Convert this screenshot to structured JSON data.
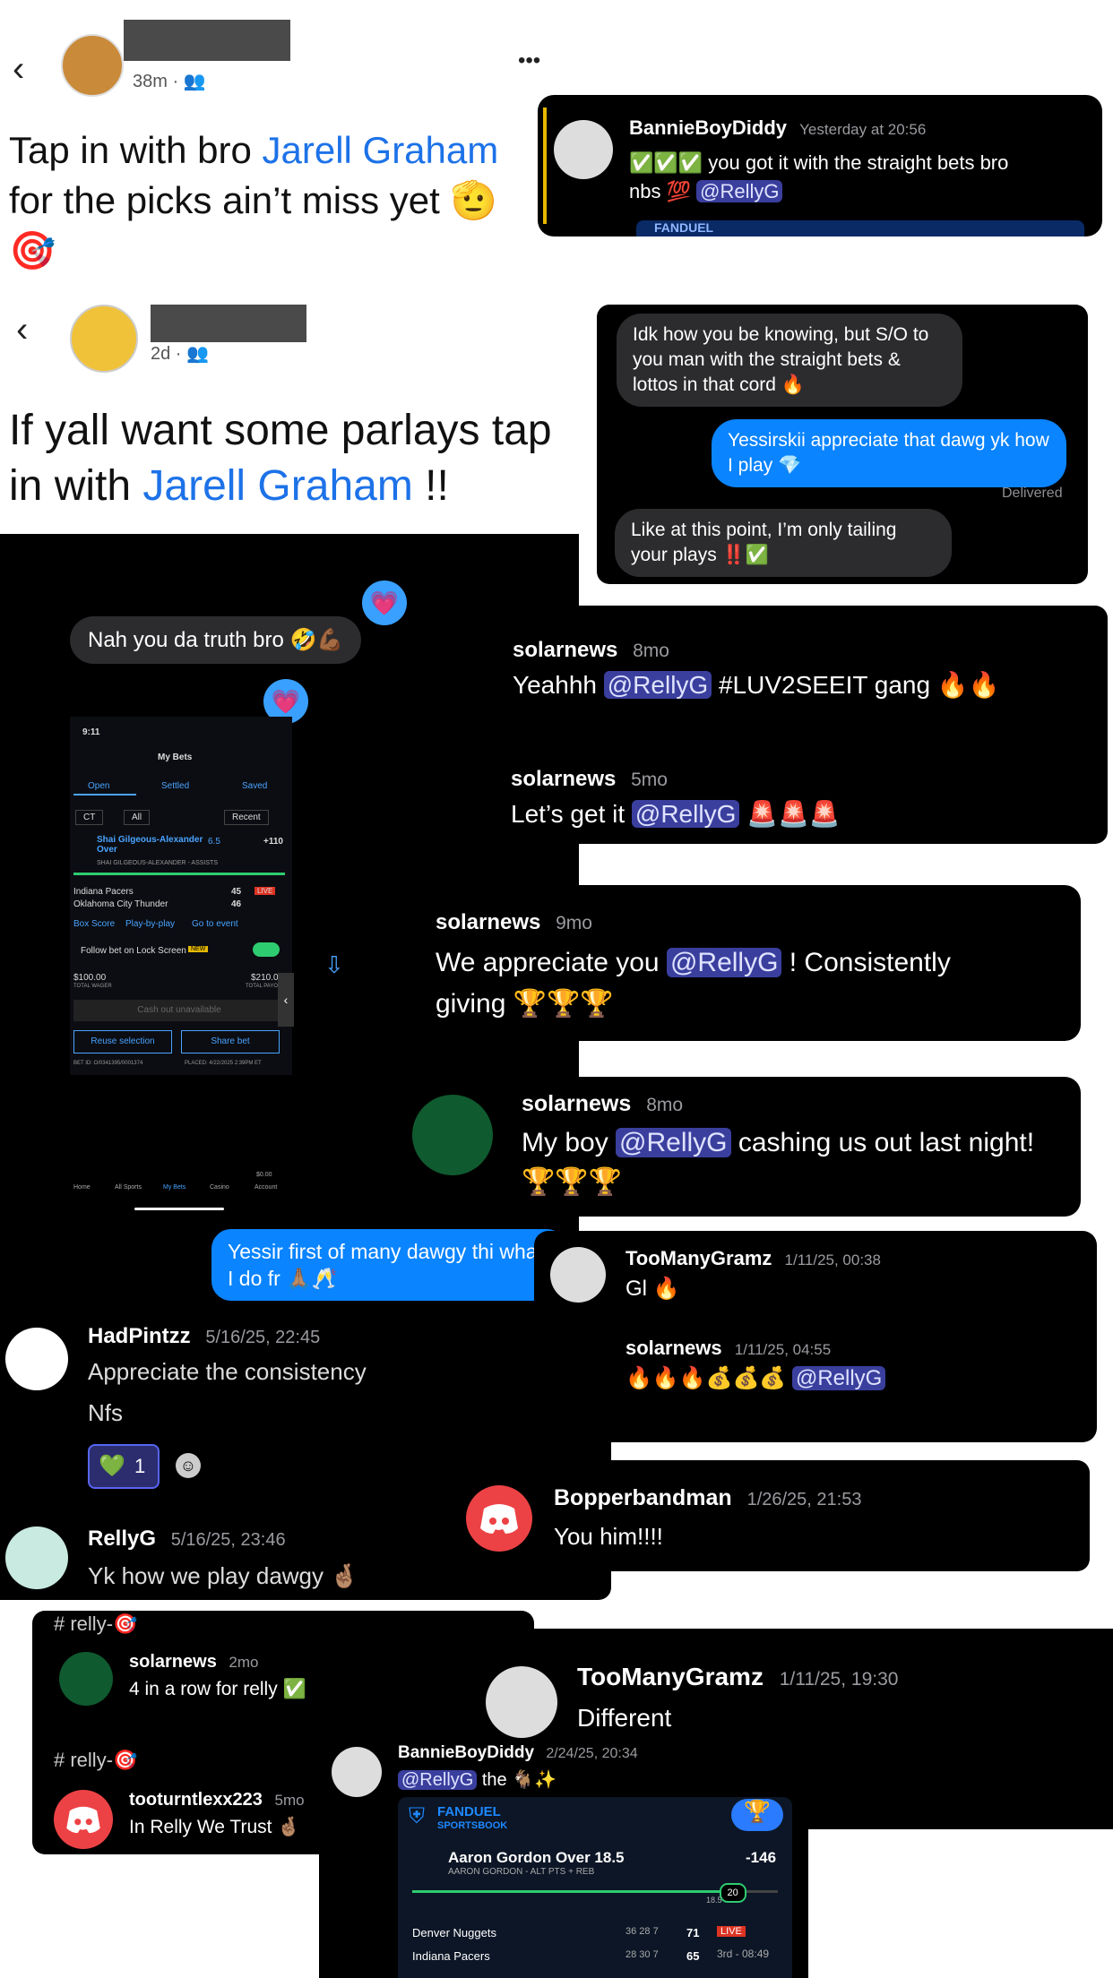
{
  "post1": {
    "time": "38m",
    "text_prefix": "Tap in with bro ",
    "text_name": "Jarell Graham",
    "text_line2": "for the picks ain’t miss yet 🫡",
    "text_line3": "🎯",
    "more_label": "•••"
  },
  "card1": {
    "name": "BannieBoyDiddy",
    "time": "Yesterday at 20:56",
    "line1": "✅✅✅ you got it with the straight bets bro",
    "line2": "nbs 💯",
    "mention": "@RellyG",
    "brand": "FANDUEL"
  },
  "post2": {
    "time": "2d",
    "line1": "If yall want some parlays tap",
    "line2_prefix": "in with ",
    "line2_name": "Jarell Graham",
    "line2_suffix": " !!"
  },
  "imsg1": {
    "msg1": "Idk how you be knowing, but S/O to you man with the straight bets & lottos in that cord 🔥",
    "msg2": "Yessirskii appreciate that dawg yk how I play 💎",
    "delivered": "Delivered",
    "msg3": "Like at this point, I’m only tailing your plays ‼️✅"
  },
  "imsg2": {
    "msg1": "Nah you da truth bro 🤣💪🏾",
    "msg2": "Yessir first of many dawgy thi what I do fr 🙏🏽🥂"
  },
  "betslip": {
    "time": "9:11",
    "title": "My Bets",
    "tabs": [
      "Open",
      "Settled",
      "Saved"
    ],
    "filters": [
      "CT",
      "All",
      "Recent"
    ],
    "player": "Shai Gilgeous-Alexander Over",
    "line": "6.5",
    "odds": "+110",
    "sub": "SHAI GILGEOUS-ALEXANDER - ASSISTS",
    "team1": "Indiana Pacers",
    "team2": "Oklahoma City Thunder",
    "score1": "45",
    "score2": "46",
    "live": "LIVE",
    "links": [
      "Box Score",
      "Play-by-play",
      "Go to event"
    ],
    "follow": "Follow bet on Lock Screen",
    "new_badge": "NEW",
    "wager": "$100.00",
    "wager_label": "TOTAL WAGER",
    "payout": "$210.0",
    "payout_label": "TOTAL PAYO",
    "cashout": "Cash out unavailable",
    "reuse": "Reuse selection",
    "share": "Share bet",
    "betid": "BET ID: O/0341395/0001374",
    "placed": "PLACED: 4/22/2025 2:39PM ET",
    "nav": [
      "Home",
      "All Sports",
      "My Bets",
      "Casino",
      "Account"
    ],
    "balance": "$0.00"
  },
  "sn1": {
    "name": "solarnews",
    "time": "8mo",
    "text": "Yeahhh",
    "mention": "@RellyG",
    "suffix": "#LUV2SEEIT gang 🔥🔥"
  },
  "sn2": {
    "name": "solarnews",
    "time": "5mo",
    "text": "Let’s get it",
    "mention": "@RellyG",
    "suffix": "🚨🚨🚨"
  },
  "sn3": {
    "name": "solarnews",
    "time": "9mo",
    "text": "We appreciate you",
    "mention": "@RellyG",
    "suffix": "! Consistently",
    "line2": "giving 🏆🏆🏆"
  },
  "sn4": {
    "name": "solarnews",
    "time": "8mo",
    "text": "My boy",
    "mention": "@RellyG",
    "suffix": "cashing us out last night!",
    "line2": "🏆🏆🏆"
  },
  "tmg1": {
    "name": "TooManyGramz",
    "time": "1/11/25, 00:38",
    "text": "Gl 🔥",
    "reply_name": "solarnews",
    "reply_time": "1/11/25, 04:55",
    "reply_text": "🔥🔥🔥💰💰💰",
    "reply_mention": "@RellyG"
  },
  "hp": {
    "name": "HadPintzz",
    "time": "5/16/25, 22:45",
    "line1": "Appreciate the consistency",
    "line2": "Nfs",
    "reaction": "💚",
    "reaction_count": "1"
  },
  "rg": {
    "name": "RellyG",
    "time": "5/16/25, 23:46",
    "text": "Yk how we play dawgy 🤞🏽"
  },
  "bop": {
    "name": "Bopperbandman",
    "time": "1/26/25, 21:53",
    "text": "You him!!!!"
  },
  "ch1": {
    "channel": "relly-🎯",
    "name": "solarnews",
    "time": "2mo",
    "text": "4 in a row for relly ✅",
    "channel2": "relly-🎯",
    "name2": "tooturntlexx223",
    "time2": "5mo",
    "text2": "In Relly We Trust 🤞🏽"
  },
  "tmg2": {
    "name": "TooManyGramz",
    "time": "1/11/25, 19:30",
    "text": "Different"
  },
  "bbd2": {
    "name": "BannieBoyDiddy",
    "time": "2/24/25, 20:34",
    "mention": "@RellyG",
    "text": "the 🐐✨",
    "brand1": "FANDUEL",
    "brand2": "SPORTSBOOK",
    "player": "Aaron Gordon Over 18.5",
    "sub": "AARON GORDON - ALT PTS + REB",
    "odds": "-146",
    "progress_val": "20",
    "progress_line": "18.5",
    "team1": "Denver Nuggets",
    "team1_q": "36 28 7",
    "team1_score": "71",
    "team2": "Indiana Pacers",
    "team2_q": "28 30 7",
    "team2_score": "65",
    "live": "LIVE",
    "clock": "3rd - 08:49"
  }
}
